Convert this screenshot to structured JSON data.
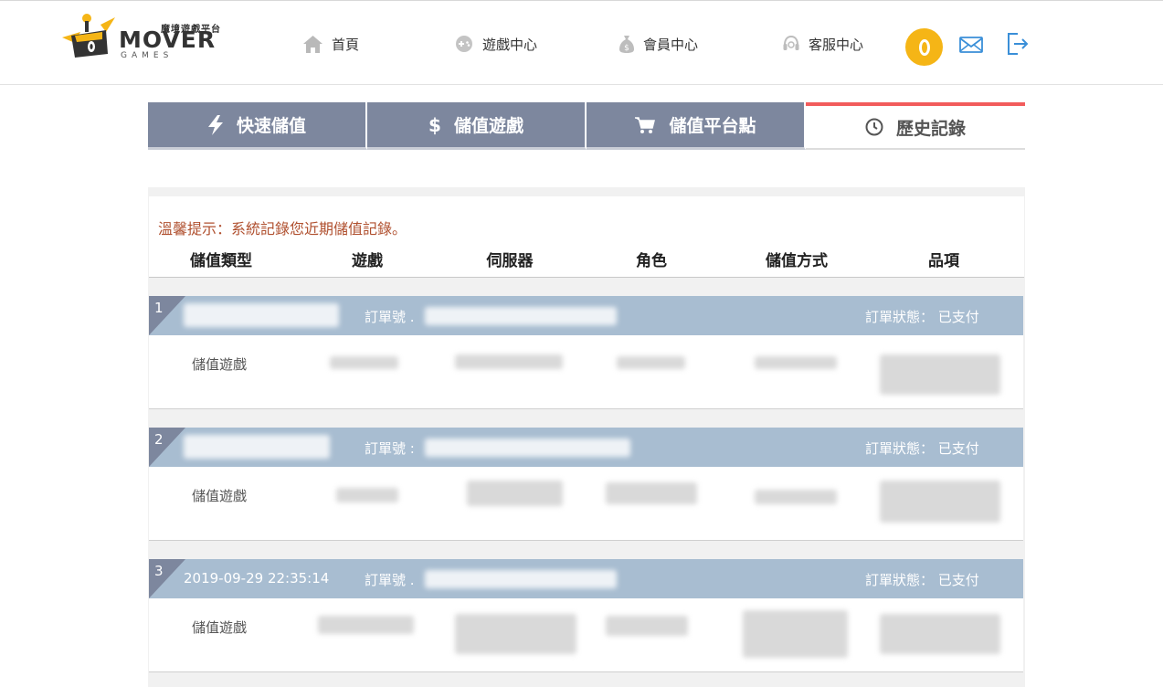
{
  "brand": {
    "subtitle": "魔境遊戲平台",
    "word": "MOVER",
    "games": "GAMES"
  },
  "nav": {
    "home": "首頁",
    "games": "遊戲中心",
    "member": "會員中心",
    "support": "客服中心"
  },
  "tabs": [
    "快速儲值",
    "儲值遊戲",
    "儲值平台點",
    "歷史記錄"
  ],
  "notice": "溫馨提示：系統記錄您近期儲值記錄。",
  "columns": [
    "儲值類型",
    "遊戲",
    "伺服器",
    "角色",
    "儲值方式",
    "品項"
  ],
  "orders": [
    {
      "num": "1",
      "date": "",
      "order_label": "訂單號 .",
      "status": "訂單狀態： 已支付",
      "type": "儲值遊戲"
    },
    {
      "num": "2",
      "date": "",
      "order_label": "訂單號 :",
      "status": "訂單狀態： 已支付",
      "type": "儲值遊戲"
    },
    {
      "num": "3",
      "date": "2019-09-29 22:35:14",
      "order_label": "訂單號 .",
      "status": "訂單狀態： 已支付",
      "type": "儲值遊戲"
    }
  ],
  "colors": {
    "tab": "#7d879e",
    "tab_active_top": "#f25c5c",
    "order_bar": "#a8bdd1",
    "notice": "#b0502f",
    "coin": "#f5b516",
    "icon_blue": "#3a8fd8"
  }
}
